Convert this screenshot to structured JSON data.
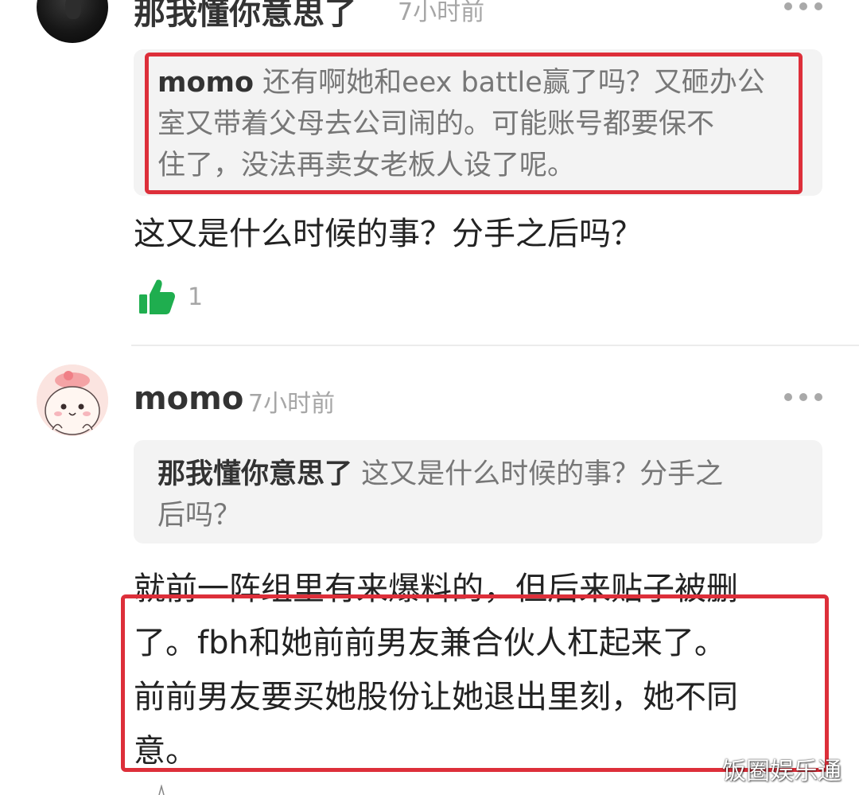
{
  "comments": [
    {
      "author": "那我懂你意思了",
      "time": "7小时前",
      "quote": {
        "author": "momo",
        "text_lines": [
          " 还有啊她和eex battle赢了吗？又砸办公",
          "室又带着父母去公司闹的。可能账号都要保不",
          "住了，没法再卖女老板人设了呢。"
        ]
      },
      "body_lines": [
        "这又是什么时候的事？分手之后吗？"
      ],
      "likes": "1"
    },
    {
      "author": "momo",
      "time": "7小时前",
      "quote": {
        "author": "那我懂你意思了",
        "text_lines": [
          " 这又是什么时候的事？分手之",
          "后吗？"
        ]
      },
      "body_lines": [
        "就前一阵组里有来爆料的，但后来贴子被删",
        "了。fbh和她前前男友兼合伙人杠起来了。",
        "前前男友要买她股份让她退出里刻，她不同",
        "意。"
      ]
    }
  ],
  "watermark": "饭圈娱乐通",
  "icons": {
    "more": "more-icon",
    "like": "thumbs-up-icon",
    "avatar_1": "avatar",
    "avatar_2": "avatar"
  },
  "colors": {
    "highlight_border": "#dd2f3a",
    "like_green": "#1fae4f",
    "quote_bg": "#f3f3f3",
    "meta_text": "#a6a6a6"
  }
}
